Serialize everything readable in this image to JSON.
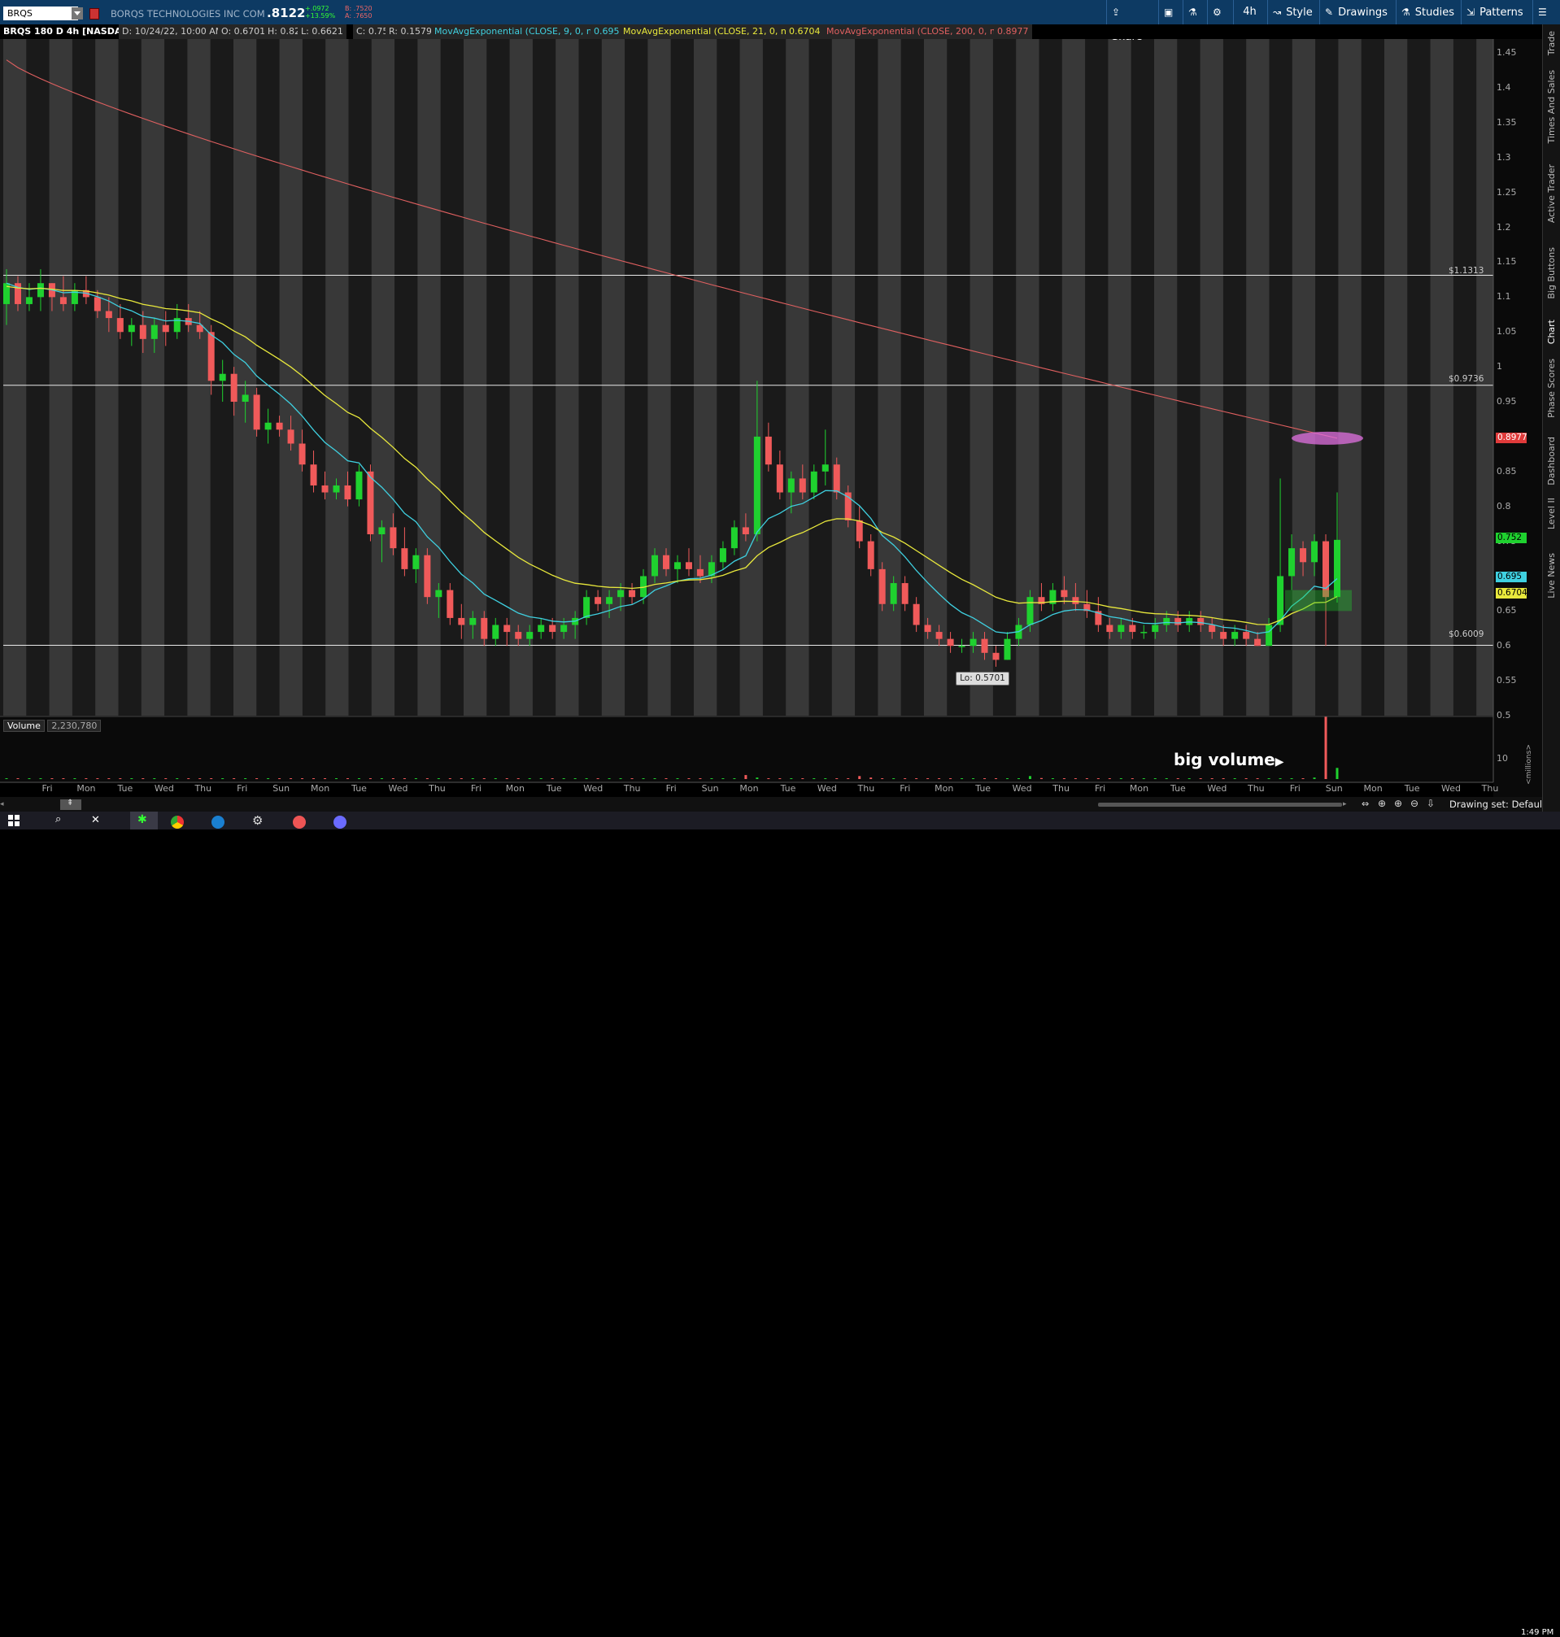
{
  "header": {
    "symbol": "BRQS",
    "company": "BORQS TECHNOLOGIES INC COM",
    "last_price": ".8122",
    "net_change": "+.0972",
    "pct_change": "+13.59%",
    "bid": "B: .7520",
    "ask": "A: .7650",
    "buttons": {
      "share": "Share",
      "timeframe": "4h",
      "style": "Style",
      "drawings": "Drawings",
      "studies": "Studies",
      "patterns": "Patterns"
    }
  },
  "study_line": {
    "chart_title": "BRQS 180 D 4h [NASDAQ]",
    "date": "D: 10/24/22, 10:00 AM",
    "open": "O: 0.6701",
    "high": "H: 0.82",
    "low": "L: 0.6621",
    "close": "C: 0.752",
    "range": "R: 0.1579",
    "ema9_label": "MovAvgExponential (CLOSE, 9, 0, no)",
    "ema9_value": "0.695",
    "ema21_label": "MovAvgExponential (CLOSE, 21, 0, no)",
    "ema21_value": "0.6704",
    "ema200_label": "MovAvgExponential (CLOSE, 200, 0, no)",
    "ema200_value": "0.8977"
  },
  "price_axis": {
    "ticks": [
      "1.45",
      "1.4",
      "1.35",
      "1.3",
      "1.25",
      "1.2",
      "1.15",
      "1.1",
      "1.05",
      "1",
      "0.95",
      "0.9",
      "0.85",
      "0.8",
      "0.75",
      "0.7",
      "0.65",
      "0.6",
      "0.55",
      "0.5"
    ],
    "tags": {
      "ema200": "0.8977",
      "last": "0.752",
      "ema9": "0.695",
      "ema21": "0.6704"
    }
  },
  "horizontal_lines": [
    "$1.1313",
    "$0.9736",
    "$0.6009"
  ],
  "low_label": "Lo: 0.5701",
  "volume": {
    "label": "Volume",
    "value": "2,230,780",
    "axis_tick": "10",
    "axis_unit": "<millions>",
    "annotation": "big volume"
  },
  "time_axis": [
    "Fri",
    "Mon",
    "Tue",
    "Wed",
    "Thu",
    "Fri",
    "Sun",
    "Mon",
    "Tue",
    "Wed",
    "Thu",
    "Fri",
    "Mon",
    "Tue",
    "Wed",
    "Thu",
    "Fri",
    "Sun",
    "Mon",
    "Tue",
    "Wed",
    "Thu",
    "Fri",
    "Mon",
    "Tue",
    "Wed",
    "Thu",
    "Fri",
    "Mon",
    "Tue",
    "Wed",
    "Thu",
    "Fri",
    "Sun",
    "Mon",
    "Tue",
    "Wed",
    "Thu"
  ],
  "side_tabs": [
    "Trade",
    "Times And Sales",
    "Active Trader",
    "Big Buttons",
    "Chart",
    "Phase Scores",
    "Dashboard",
    "Level II",
    "Live News"
  ],
  "footer": {
    "drawing_set": "Drawing set: Default",
    "clock": "1:49 PM"
  },
  "colors": {
    "up": "#1fd12f",
    "down": "#f05a5a",
    "ema9": "#3fd0e0",
    "ema21": "#e8e83c",
    "ema200": "#e06060",
    "highlight": "#e070e0"
  },
  "chart_data": {
    "type": "candlestick",
    "ylim": [
      0.5,
      1.47
    ],
    "levels": [
      1.1313,
      0.9736,
      0.6009
    ],
    "candles": [
      {
        "o": 1.09,
        "h": 1.14,
        "l": 1.06,
        "c": 1.12
      },
      {
        "o": 1.12,
        "h": 1.13,
        "l": 1.08,
        "c": 1.09
      },
      {
        "o": 1.09,
        "h": 1.12,
        "l": 1.08,
        "c": 1.1
      },
      {
        "o": 1.1,
        "h": 1.14,
        "l": 1.08,
        "c": 1.12
      },
      {
        "o": 1.12,
        "h": 1.12,
        "l": 1.08,
        "c": 1.1
      },
      {
        "o": 1.1,
        "h": 1.13,
        "l": 1.08,
        "c": 1.09
      },
      {
        "o": 1.09,
        "h": 1.12,
        "l": 1.08,
        "c": 1.11
      },
      {
        "o": 1.11,
        "h": 1.13,
        "l": 1.09,
        "c": 1.1
      },
      {
        "o": 1.1,
        "h": 1.11,
        "l": 1.07,
        "c": 1.08
      },
      {
        "o": 1.08,
        "h": 1.1,
        "l": 1.05,
        "c": 1.07
      },
      {
        "o": 1.07,
        "h": 1.09,
        "l": 1.04,
        "c": 1.05
      },
      {
        "o": 1.05,
        "h": 1.07,
        "l": 1.03,
        "c": 1.06
      },
      {
        "o": 1.06,
        "h": 1.08,
        "l": 1.02,
        "c": 1.04
      },
      {
        "o": 1.04,
        "h": 1.07,
        "l": 1.02,
        "c": 1.06
      },
      {
        "o": 1.06,
        "h": 1.08,
        "l": 1.03,
        "c": 1.05
      },
      {
        "o": 1.05,
        "h": 1.09,
        "l": 1.04,
        "c": 1.07
      },
      {
        "o": 1.07,
        "h": 1.09,
        "l": 1.05,
        "c": 1.06
      },
      {
        "o": 1.06,
        "h": 1.08,
        "l": 1.04,
        "c": 1.05
      },
      {
        "o": 1.05,
        "h": 1.06,
        "l": 0.96,
        "c": 0.98
      },
      {
        "o": 0.98,
        "h": 1.01,
        "l": 0.95,
        "c": 0.99
      },
      {
        "o": 0.99,
        "h": 1.0,
        "l": 0.93,
        "c": 0.95
      },
      {
        "o": 0.95,
        "h": 0.98,
        "l": 0.92,
        "c": 0.96
      },
      {
        "o": 0.96,
        "h": 0.97,
        "l": 0.9,
        "c": 0.91
      },
      {
        "o": 0.91,
        "h": 0.94,
        "l": 0.89,
        "c": 0.92
      },
      {
        "o": 0.92,
        "h": 0.93,
        "l": 0.9,
        "c": 0.91
      },
      {
        "o": 0.91,
        "h": 0.93,
        "l": 0.88,
        "c": 0.89
      },
      {
        "o": 0.89,
        "h": 0.91,
        "l": 0.85,
        "c": 0.86
      },
      {
        "o": 0.86,
        "h": 0.88,
        "l": 0.82,
        "c": 0.83
      },
      {
        "o": 0.83,
        "h": 0.85,
        "l": 0.81,
        "c": 0.82
      },
      {
        "o": 0.82,
        "h": 0.84,
        "l": 0.81,
        "c": 0.83
      },
      {
        "o": 0.83,
        "h": 0.85,
        "l": 0.8,
        "c": 0.81
      },
      {
        "o": 0.81,
        "h": 0.86,
        "l": 0.8,
        "c": 0.85
      },
      {
        "o": 0.85,
        "h": 0.86,
        "l": 0.75,
        "c": 0.76
      },
      {
        "o": 0.76,
        "h": 0.78,
        "l": 0.72,
        "c": 0.77
      },
      {
        "o": 0.77,
        "h": 0.79,
        "l": 0.73,
        "c": 0.74
      },
      {
        "o": 0.74,
        "h": 0.77,
        "l": 0.7,
        "c": 0.71
      },
      {
        "o": 0.71,
        "h": 0.74,
        "l": 0.69,
        "c": 0.73
      },
      {
        "o": 0.73,
        "h": 0.74,
        "l": 0.66,
        "c": 0.67
      },
      {
        "o": 0.67,
        "h": 0.69,
        "l": 0.64,
        "c": 0.68
      },
      {
        "o": 0.68,
        "h": 0.69,
        "l": 0.63,
        "c": 0.64
      },
      {
        "o": 0.64,
        "h": 0.66,
        "l": 0.61,
        "c": 0.63
      },
      {
        "o": 0.63,
        "h": 0.65,
        "l": 0.61,
        "c": 0.64
      },
      {
        "o": 0.64,
        "h": 0.65,
        "l": 0.6,
        "c": 0.61
      },
      {
        "o": 0.61,
        "h": 0.64,
        "l": 0.6,
        "c": 0.63
      },
      {
        "o": 0.63,
        "h": 0.64,
        "l": 0.6,
        "c": 0.62
      },
      {
        "o": 0.62,
        "h": 0.63,
        "l": 0.6,
        "c": 0.61
      },
      {
        "o": 0.61,
        "h": 0.63,
        "l": 0.6,
        "c": 0.62
      },
      {
        "o": 0.62,
        "h": 0.64,
        "l": 0.61,
        "c": 0.63
      },
      {
        "o": 0.63,
        "h": 0.64,
        "l": 0.61,
        "c": 0.62
      },
      {
        "o": 0.62,
        "h": 0.64,
        "l": 0.61,
        "c": 0.63
      },
      {
        "o": 0.63,
        "h": 0.65,
        "l": 0.61,
        "c": 0.64
      },
      {
        "o": 0.64,
        "h": 0.68,
        "l": 0.63,
        "c": 0.67
      },
      {
        "o": 0.67,
        "h": 0.68,
        "l": 0.65,
        "c": 0.66
      },
      {
        "o": 0.66,
        "h": 0.68,
        "l": 0.64,
        "c": 0.67
      },
      {
        "o": 0.67,
        "h": 0.69,
        "l": 0.65,
        "c": 0.68
      },
      {
        "o": 0.68,
        "h": 0.69,
        "l": 0.66,
        "c": 0.67
      },
      {
        "o": 0.67,
        "h": 0.71,
        "l": 0.66,
        "c": 0.7
      },
      {
        "o": 0.7,
        "h": 0.74,
        "l": 0.69,
        "c": 0.73
      },
      {
        "o": 0.73,
        "h": 0.74,
        "l": 0.7,
        "c": 0.71
      },
      {
        "o": 0.71,
        "h": 0.73,
        "l": 0.69,
        "c": 0.72
      },
      {
        "o": 0.72,
        "h": 0.74,
        "l": 0.7,
        "c": 0.71
      },
      {
        "o": 0.71,
        "h": 0.73,
        "l": 0.69,
        "c": 0.7
      },
      {
        "o": 0.7,
        "h": 0.73,
        "l": 0.69,
        "c": 0.72
      },
      {
        "o": 0.72,
        "h": 0.75,
        "l": 0.71,
        "c": 0.74
      },
      {
        "o": 0.74,
        "h": 0.78,
        "l": 0.73,
        "c": 0.77
      },
      {
        "o": 0.77,
        "h": 0.79,
        "l": 0.75,
        "c": 0.76
      },
      {
        "o": 0.76,
        "h": 0.98,
        "l": 0.75,
        "c": 0.9
      },
      {
        "o": 0.9,
        "h": 0.92,
        "l": 0.85,
        "c": 0.86
      },
      {
        "o": 0.86,
        "h": 0.88,
        "l": 0.81,
        "c": 0.82
      },
      {
        "o": 0.82,
        "h": 0.85,
        "l": 0.79,
        "c": 0.84
      },
      {
        "o": 0.84,
        "h": 0.86,
        "l": 0.81,
        "c": 0.82
      },
      {
        "o": 0.82,
        "h": 0.86,
        "l": 0.81,
        "c": 0.85
      },
      {
        "o": 0.85,
        "h": 0.91,
        "l": 0.83,
        "c": 0.86
      },
      {
        "o": 0.86,
        "h": 0.87,
        "l": 0.81,
        "c": 0.82
      },
      {
        "o": 0.82,
        "h": 0.83,
        "l": 0.77,
        "c": 0.78
      },
      {
        "o": 0.78,
        "h": 0.8,
        "l": 0.74,
        "c": 0.75
      },
      {
        "o": 0.75,
        "h": 0.76,
        "l": 0.7,
        "c": 0.71
      },
      {
        "o": 0.71,
        "h": 0.72,
        "l": 0.65,
        "c": 0.66
      },
      {
        "o": 0.66,
        "h": 0.7,
        "l": 0.65,
        "c": 0.69
      },
      {
        "o": 0.69,
        "h": 0.7,
        "l": 0.65,
        "c": 0.66
      },
      {
        "o": 0.66,
        "h": 0.67,
        "l": 0.62,
        "c": 0.63
      },
      {
        "o": 0.63,
        "h": 0.64,
        "l": 0.61,
        "c": 0.62
      },
      {
        "o": 0.62,
        "h": 0.63,
        "l": 0.6,
        "c": 0.61
      },
      {
        "o": 0.61,
        "h": 0.62,
        "l": 0.59,
        "c": 0.6
      },
      {
        "o": 0.6,
        "h": 0.61,
        "l": 0.59,
        "c": 0.6
      },
      {
        "o": 0.6,
        "h": 0.62,
        "l": 0.59,
        "c": 0.61
      },
      {
        "o": 0.61,
        "h": 0.62,
        "l": 0.58,
        "c": 0.59
      },
      {
        "o": 0.59,
        "h": 0.6,
        "l": 0.5701,
        "c": 0.58
      },
      {
        "o": 0.58,
        "h": 0.62,
        "l": 0.58,
        "c": 0.61
      },
      {
        "o": 0.61,
        "h": 0.64,
        "l": 0.6,
        "c": 0.63
      },
      {
        "o": 0.63,
        "h": 0.68,
        "l": 0.62,
        "c": 0.67
      },
      {
        "o": 0.67,
        "h": 0.69,
        "l": 0.65,
        "c": 0.66
      },
      {
        "o": 0.66,
        "h": 0.69,
        "l": 0.65,
        "c": 0.68
      },
      {
        "o": 0.68,
        "h": 0.7,
        "l": 0.66,
        "c": 0.67
      },
      {
        "o": 0.67,
        "h": 0.69,
        "l": 0.65,
        "c": 0.66
      },
      {
        "o": 0.66,
        "h": 0.68,
        "l": 0.64,
        "c": 0.65
      },
      {
        "o": 0.65,
        "h": 0.67,
        "l": 0.62,
        "c": 0.63
      },
      {
        "o": 0.63,
        "h": 0.64,
        "l": 0.61,
        "c": 0.62
      },
      {
        "o": 0.62,
        "h": 0.64,
        "l": 0.61,
        "c": 0.63
      },
      {
        "o": 0.63,
        "h": 0.64,
        "l": 0.61,
        "c": 0.62
      },
      {
        "o": 0.62,
        "h": 0.63,
        "l": 0.61,
        "c": 0.62
      },
      {
        "o": 0.62,
        "h": 0.64,
        "l": 0.61,
        "c": 0.63
      },
      {
        "o": 0.63,
        "h": 0.65,
        "l": 0.62,
        "c": 0.64
      },
      {
        "o": 0.64,
        "h": 0.65,
        "l": 0.62,
        "c": 0.63
      },
      {
        "o": 0.63,
        "h": 0.65,
        "l": 0.62,
        "c": 0.64
      },
      {
        "o": 0.64,
        "h": 0.65,
        "l": 0.62,
        "c": 0.63
      },
      {
        "o": 0.63,
        "h": 0.64,
        "l": 0.61,
        "c": 0.62
      },
      {
        "o": 0.62,
        "h": 0.63,
        "l": 0.6,
        "c": 0.61
      },
      {
        "o": 0.61,
        "h": 0.63,
        "l": 0.6,
        "c": 0.62
      },
      {
        "o": 0.62,
        "h": 0.63,
        "l": 0.6,
        "c": 0.61
      },
      {
        "o": 0.61,
        "h": 0.62,
        "l": 0.6,
        "c": 0.6
      },
      {
        "o": 0.6,
        "h": 0.64,
        "l": 0.6,
        "c": 0.63
      },
      {
        "o": 0.63,
        "h": 0.84,
        "l": 0.62,
        "c": 0.7
      },
      {
        "o": 0.7,
        "h": 0.76,
        "l": 0.68,
        "c": 0.74
      },
      {
        "o": 0.74,
        "h": 0.75,
        "l": 0.7,
        "c": 0.72
      },
      {
        "o": 0.72,
        "h": 0.76,
        "l": 0.7,
        "c": 0.75
      },
      {
        "o": 0.75,
        "h": 0.76,
        "l": 0.6,
        "c": 0.67
      },
      {
        "o": 0.6701,
        "h": 0.82,
        "l": 0.6621,
        "c": 0.752
      }
    ],
    "volume_millions": [
      0.1,
      0.05,
      0.05,
      0.1,
      0.05,
      0.05,
      0.05,
      0.05,
      0.05,
      0.05,
      0.05,
      0.05,
      0.05,
      0.05,
      0.05,
      0.05,
      0.05,
      0.05,
      0.1,
      0.05,
      0.1,
      0.05,
      0.1,
      0.05,
      0.05,
      0.05,
      0.05,
      0.1,
      0.05,
      0.05,
      0.05,
      0.05,
      0.1,
      0.05,
      0.05,
      0.05,
      0.05,
      0.1,
      0.05,
      0.05,
      0.05,
      0.05,
      0.05,
      0.05,
      0.05,
      0.05,
      0.05,
      0.05,
      0.05,
      0.05,
      0.05,
      0.05,
      0.05,
      0.05,
      0.05,
      0.05,
      0.05,
      0.05,
      0.05,
      0.05,
      0.05,
      0.05,
      0.05,
      0.05,
      0.05,
      0.8,
      0.3,
      0.1,
      0.05,
      0.1,
      0.05,
      0.1,
      0.05,
      0.05,
      0.05,
      0.6,
      0.3,
      0.1,
      0.05,
      0.05,
      0.05,
      0.05,
      0.05,
      0.05,
      0.05,
      0.05,
      0.05,
      0.05,
      0.1,
      0.05,
      0.6,
      0.2,
      0.1,
      0.05,
      0.05,
      0.05,
      0.05,
      0.05,
      0.05,
      0.05,
      0.05,
      0.05,
      0.1,
      0.05,
      0.05,
      0.05,
      0.05,
      0.05,
      0.05,
      0.05,
      0.05,
      0.05,
      0.05,
      0.05,
      0.05,
      0.3,
      12.5,
      1.0,
      0.3,
      0.2,
      0.8,
      2.23
    ]
  }
}
